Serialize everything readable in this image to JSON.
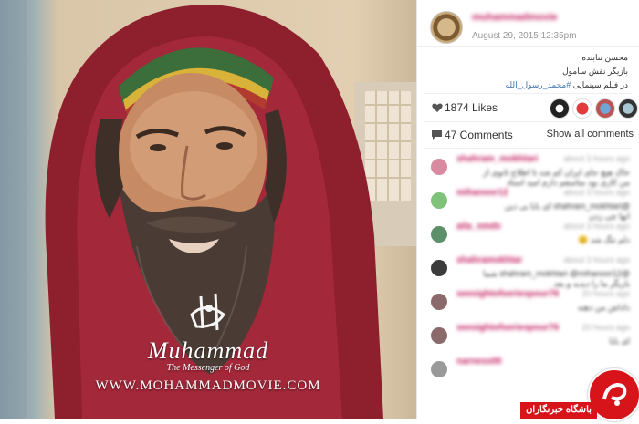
{
  "photo": {
    "watermark_name": "Muhammad",
    "watermark_subtitle": "The Messenger of God",
    "watermark_url": "WWW.MOHAMMADMOVIE.COM"
  },
  "post": {
    "username": "muhammadmovie",
    "date": "August 29, 2015 12:35pm",
    "caption_lines": [
      "محسن تنابنده",
      "بازیگر نقش سامول",
      "در فیلم سینمایی "
    ],
    "caption_hashtag": "#محمد_رسول_الله"
  },
  "likes": {
    "count_text": "1874 Likes"
  },
  "comments_header": {
    "count_text": "47 Comments",
    "show_all": "Show all comments"
  },
  "comments": [
    {
      "user": "shahram_mokhtari",
      "time": "about 3 hours ago",
      "line1": "خاک هیچ جای ایران کم شد تا اطلاع ثانوی از",
      "line2": "من کاری بود متاسفم دارم امید استاد",
      "avatar_color": "#d88aa0"
    },
    {
      "user": "mihanoor12",
      "time": "about 3 hours ago",
      "line1": "@shahram_mokhtari ای بابا بی دین",
      "line2": "انها چی زدن",
      "avatar_color": "#7fc27a"
    },
    {
      "user": "aila_nmdv",
      "time": "about 3 hours ago",
      "line1": "دلم تنگ شد 😊",
      "line2": "",
      "avatar_color": "#5c8f6a"
    },
    {
      "user": "shahramokhtar",
      "time": "about 3 hours ago",
      "line1": "@shahram_mokhtari @mihanoor12 شما",
      "line2": "بازیگر ما را دیدید و بعد",
      "avatar_color": "#3b3b3b"
    },
    {
      "user": "seesightofseriespour76",
      "time": "20 hours ago",
      "line1": "داداش من دهنه",
      "line2": "",
      "avatar_color": "#8a6a6a"
    },
    {
      "user": "seesightofseriespour76",
      "time": "20 hours ago",
      "line1": "ای بابا",
      "line2": "",
      "avatar_color": "#8a6a6a"
    },
    {
      "user": "narness00",
      "time": "",
      "line1": "",
      "line2": "",
      "avatar_color": "#999999"
    }
  ],
  "badge": {
    "label": "باشگاه خبرنگاران"
  },
  "colors": {
    "username": "#c2185b",
    "link": "#3f72af",
    "badge_red": "#d7141a"
  }
}
